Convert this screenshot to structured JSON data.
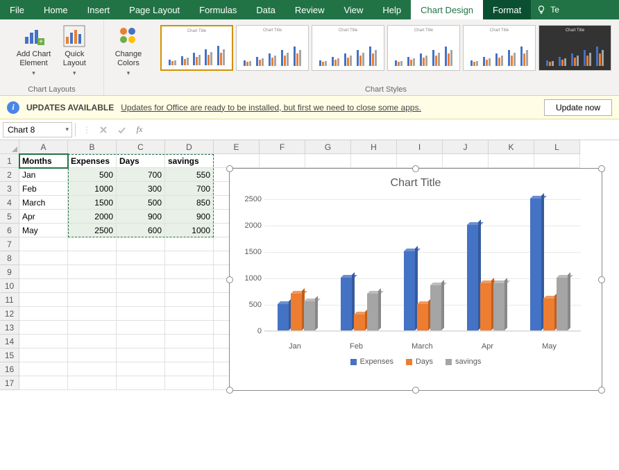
{
  "ribbon": {
    "tabs": [
      "File",
      "Home",
      "Insert",
      "Page Layout",
      "Formulas",
      "Data",
      "Review",
      "View",
      "Help",
      "Chart Design",
      "Format",
      "Te"
    ],
    "active_tab": "Chart Design",
    "groups": {
      "chart_layouts": {
        "label": "Chart Layouts",
        "add_chart_element": "Add Chart\nElement",
        "quick_layout": "Quick\nLayout"
      },
      "change_colors": "Change\nColors",
      "chart_styles_label": "Chart Styles"
    }
  },
  "update_bar": {
    "title": "UPDATES AVAILABLE",
    "message": "Updates for Office are ready to be installed, but first we need to close some apps.",
    "button": "Update now"
  },
  "name_box": "Chart 8",
  "formula": "",
  "columns": [
    "A",
    "B",
    "C",
    "D",
    "E",
    "F",
    "G",
    "H",
    "I",
    "J",
    "K",
    "L"
  ],
  "table": {
    "headers": [
      "Months",
      "Expenses",
      "Days",
      "savings"
    ],
    "rows": [
      {
        "month": "Jan",
        "expenses": 500,
        "days": 700,
        "savings": 550
      },
      {
        "month": "Feb",
        "expenses": 1000,
        "days": 300,
        "savings": 700
      },
      {
        "month": "March",
        "expenses": 1500,
        "days": 500,
        "savings": 850
      },
      {
        "month": "Apr",
        "expenses": 2000,
        "days": 900,
        "savings": 900
      },
      {
        "month": "May",
        "expenses": 2500,
        "days": 600,
        "savings": 1000
      }
    ]
  },
  "chart_data": {
    "type": "bar",
    "title": "Chart Title",
    "categories": [
      "Jan",
      "Feb",
      "March",
      "Apr",
      "May"
    ],
    "series": [
      {
        "name": "Expenses",
        "values": [
          500,
          1000,
          1500,
          2000,
          2500
        ],
        "color": "#4472C4"
      },
      {
        "name": "Days",
        "values": [
          700,
          300,
          500,
          900,
          600
        ],
        "color": "#ED7D31"
      },
      {
        "name": "savings",
        "values": [
          550,
          700,
          850,
          900,
          1000
        ],
        "color": "#A5A5A5"
      }
    ],
    "y_ticks": [
      0,
      500,
      1000,
      1500,
      2000,
      2500
    ],
    "ylim": [
      0,
      2500
    ],
    "xlabel": "",
    "ylabel": ""
  }
}
